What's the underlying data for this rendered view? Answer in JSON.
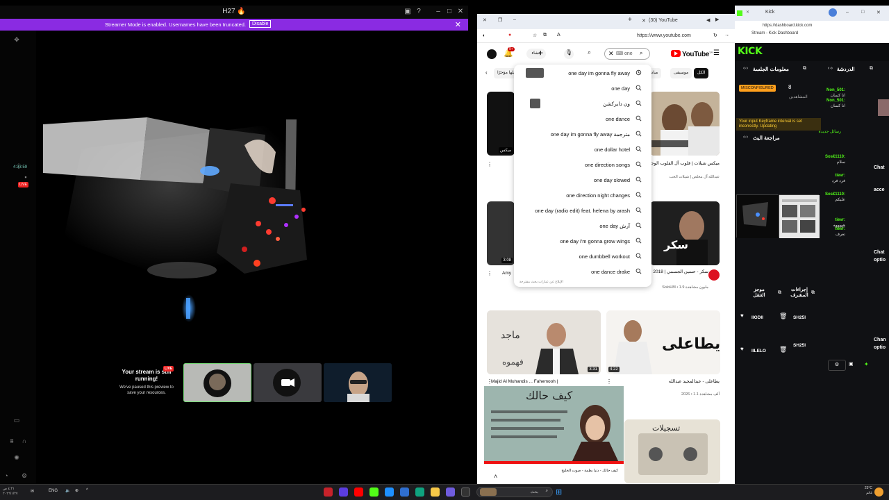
{
  "stream_app": {
    "title": "H27 🔥",
    "banner_message": "Streamer Mode is enabled. Usernames have been truncated.",
    "banner_disable": "Disable",
    "timer": "4:33:59",
    "live_mini": "LIVE",
    "paused_title": "Your stream is still running!",
    "paused_sub": "We've paused this preview to save your resources.",
    "live_badge": "LIVE"
  },
  "youtube": {
    "tab_title": "(30) YouTube",
    "url": "https://www.youtube.com",
    "search_value": "one",
    "search_placeholder": "بحث",
    "logo": "YouTube",
    "logo_country": "SA",
    "chips": [
      "الكل",
      "موسيقى",
      "مباشر",
      "تم تحميلها مؤخرًا"
    ],
    "suggestions": [
      {
        "text": "one day im gonna fly away",
        "icon": "history-icon",
        "has_image": true
      },
      {
        "text": "one day",
        "icon": "search-icon",
        "has_image": false
      },
      {
        "text": "ون دايركشن",
        "icon": "search-icon",
        "has_image": true
      },
      {
        "text": "one dance",
        "icon": "search-icon",
        "has_image": false
      },
      {
        "text": "one day im gonna fly away مترجمة",
        "icon": "search-icon",
        "has_image": false
      },
      {
        "text": "one dollar hotel",
        "icon": "search-icon",
        "has_image": false
      },
      {
        "text": "one direction songs",
        "icon": "search-icon",
        "has_image": false
      },
      {
        "text": "one day slowed",
        "icon": "search-icon",
        "has_image": false
      },
      {
        "text": "one direction night changes",
        "icon": "search-icon",
        "has_image": false
      },
      {
        "text": "one day (radio edit) feat. helena by arash",
        "icon": "search-icon",
        "has_image": false
      },
      {
        "text": "one day آرش",
        "icon": "search-icon",
        "has_image": false
      },
      {
        "text": "one day i'm gonna grow wings",
        "icon": "search-icon",
        "has_image": false
      },
      {
        "text": "one dumbbell workout",
        "icon": "search-icon",
        "has_image": false
      },
      {
        "text": "one dance drake",
        "icon": "search-icon",
        "has_image": false
      }
    ],
    "suggestions_report": "الإبلاغ عن عبارات بحث مقترحة",
    "videos": [
      {
        "title": "ميكس شيلات | قلوب آل القلوب الوجاع",
        "meta": "عبدالله آل مخلص | شيلات الحب",
        "duration": ""
      },
      {
        "title": "Amy",
        "meta": "",
        "duration": "3:08"
      },
      {
        "title": "سكر - حسين الجسمي | 2018",
        "meta": "SoloHM • 1.9 مليون مشاهدة",
        "duration": ""
      },
      {
        "title": "Majid Al Muhandis ... Fahemooh |",
        "meta": "",
        "duration": "3:31"
      },
      {
        "title": "يطاعلى - عبدالمجيد عبدالله",
        "meta": "2026 • 1.1 ألف مشاهدة",
        "duration": "4:22"
      }
    ],
    "song_card_title": "كيف حالك",
    "song_card_sub": "كيف حالك - دنيا بطمة - صوت الخليج"
  },
  "kick": {
    "tab_title": "Kick",
    "url_bar": "https://dashboard.kick.com",
    "page_title": "Stream - Kick Dashboard",
    "logo": "KICK",
    "session_title": "معلومات الجلسة",
    "chat_title": "الدردشة",
    "misconfigured": "MISCONFIGURED",
    "viewers_count": "8",
    "viewers_label": "المشاهدين",
    "warning": "Your input Keyframe interval is set incorrectly. Updating",
    "reviewer_title": "مراجعة البث",
    "mod_actions": "إجراءات المشرف",
    "mod_notes": "موجز التنقل",
    "chat_messages": [
      {
        "user": "Non_501:",
        "msg": "اتا كسان"
      },
      {
        "user": "Non_501:",
        "msg": "انا كسان"
      },
      {
        "user": "Sos€1110:",
        "msg": "سلام"
      },
      {
        "user": "tievr:",
        "msg": "فرد فرد"
      },
      {
        "user": "Sos€1110:",
        "msg": "عليكم"
      },
      {
        "user": "tievr:",
        "msg": "هههههه"
      },
      {
        "user": "tievr:",
        "msg": "تعرف"
      }
    ],
    "new_messages_label": "رسائل جديدة",
    "side_labels": [
      "Chat",
      "acce",
      "Chat",
      "optio",
      "Chan",
      "optio"
    ]
  },
  "taskbar": {
    "lang": "ENG",
    "search_placeholder": "بحث",
    "time": "٤:٣١ ص",
    "date": "٢٠٢٦/١/٢٧",
    "weather": "23°C",
    "weather_desc": "غائم"
  }
}
